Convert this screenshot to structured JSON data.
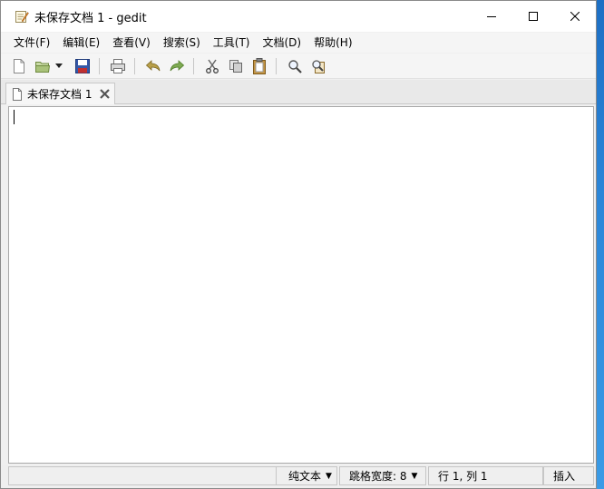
{
  "window": {
    "title": "未保存文档 1 - gedit",
    "controls": {
      "minimize": "minimize",
      "maximize": "maximize",
      "close": "close"
    }
  },
  "menu": [
    {
      "label": "文件(F)",
      "icon": "none"
    },
    {
      "label": "编辑(E)",
      "icon": "none"
    },
    {
      "label": "查看(V)",
      "icon": "none"
    },
    {
      "label": "搜索(S)",
      "icon": "none"
    },
    {
      "label": "工具(T)",
      "icon": "none"
    },
    {
      "label": "文档(D)",
      "icon": "none"
    },
    {
      "label": "帮助(H)",
      "icon": "none"
    }
  ],
  "toolbar": {
    "buttons": [
      "new-document-icon",
      "open-folder-icon",
      "open-dropdown-icon",
      "save-icon",
      "print-icon",
      "undo-icon",
      "redo-icon",
      "cut-icon",
      "copy-icon",
      "paste-icon",
      "find-icon",
      "replace-icon"
    ]
  },
  "tab": {
    "label": "未保存文档 1"
  },
  "editor": {
    "content": ""
  },
  "status": {
    "language": "纯文本",
    "tab_width": "跳格宽度: 8",
    "position": "行 1, 列 1",
    "mode": "插入"
  },
  "colors": {
    "desktop": "#2b86d8",
    "window_bg": "#f0f0f0",
    "editor_bg": "#ffffff"
  }
}
